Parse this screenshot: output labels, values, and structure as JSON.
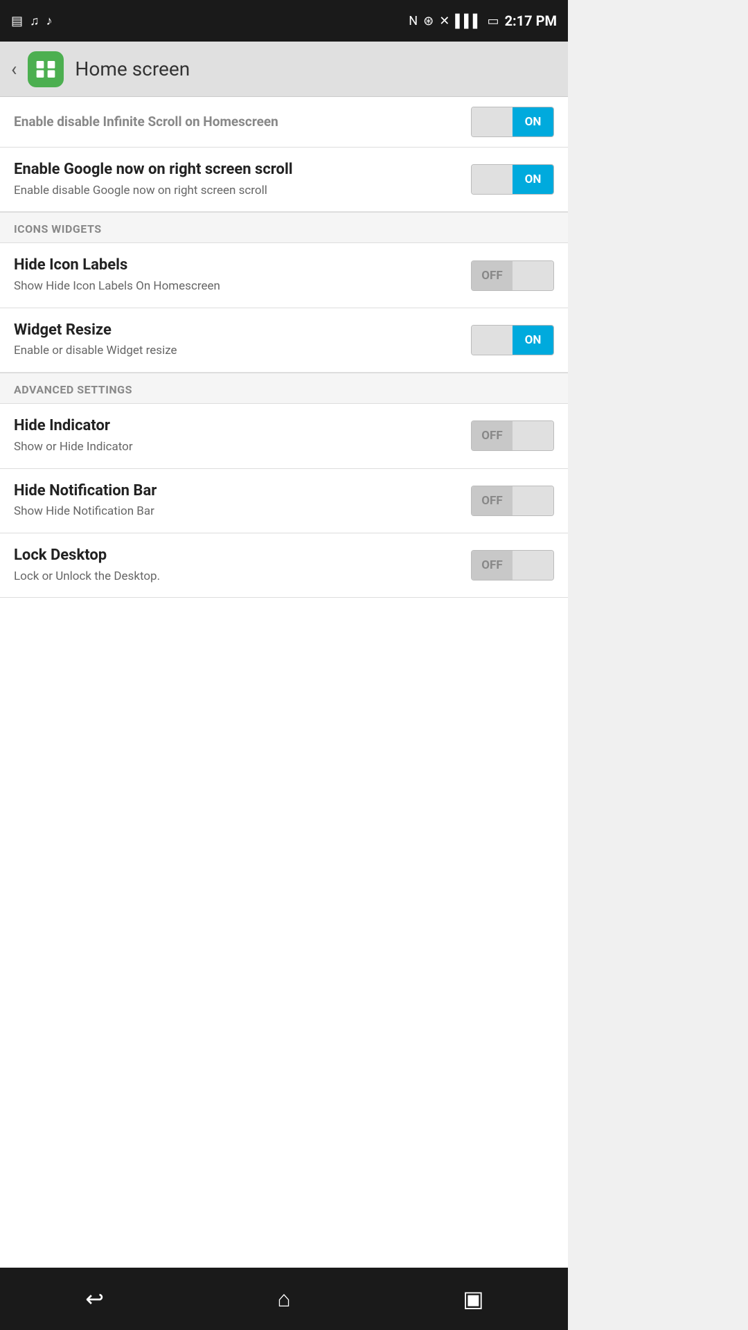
{
  "statusBar": {
    "time": "2:17 PM",
    "icons": [
      "nfc",
      "wifi",
      "signal",
      "battery"
    ]
  },
  "topBar": {
    "title": "Home screen",
    "backLabel": "‹"
  },
  "settings": {
    "partialItem": {
      "title": "Enable disable Infinite Scroll on Homescreen",
      "state": "on"
    },
    "items": [
      {
        "id": "google-now",
        "title": "Enable Google now on right screen scroll",
        "description": "Enable disable Google now on right screen scroll",
        "state": "on"
      }
    ],
    "sections": [
      {
        "id": "icons-widgets",
        "label": "ICONS WIDGETS",
        "items": [
          {
            "id": "hide-icon-labels",
            "title": "Hide Icon Labels",
            "description": "Show Hide Icon Labels On Homescreen",
            "state": "off"
          },
          {
            "id": "widget-resize",
            "title": "Widget Resize",
            "description": "Enable or disable Widget resize",
            "state": "on"
          }
        ]
      },
      {
        "id": "advanced-settings",
        "label": "ADVANCED SETTINGS",
        "items": [
          {
            "id": "hide-indicator",
            "title": "Hide Indicator",
            "description": "Show or Hide Indicator",
            "state": "off"
          },
          {
            "id": "hide-notification-bar",
            "title": "Hide Notification Bar",
            "description": "Show Hide Notification Bar",
            "state": "off"
          },
          {
            "id": "lock-desktop",
            "title": "Lock Desktop",
            "description": "Lock or Unlock the Desktop.",
            "state": "off"
          }
        ]
      }
    ]
  },
  "bottomNav": {
    "backLabel": "↩",
    "homeLabel": "⌂",
    "recentLabel": "▣"
  }
}
